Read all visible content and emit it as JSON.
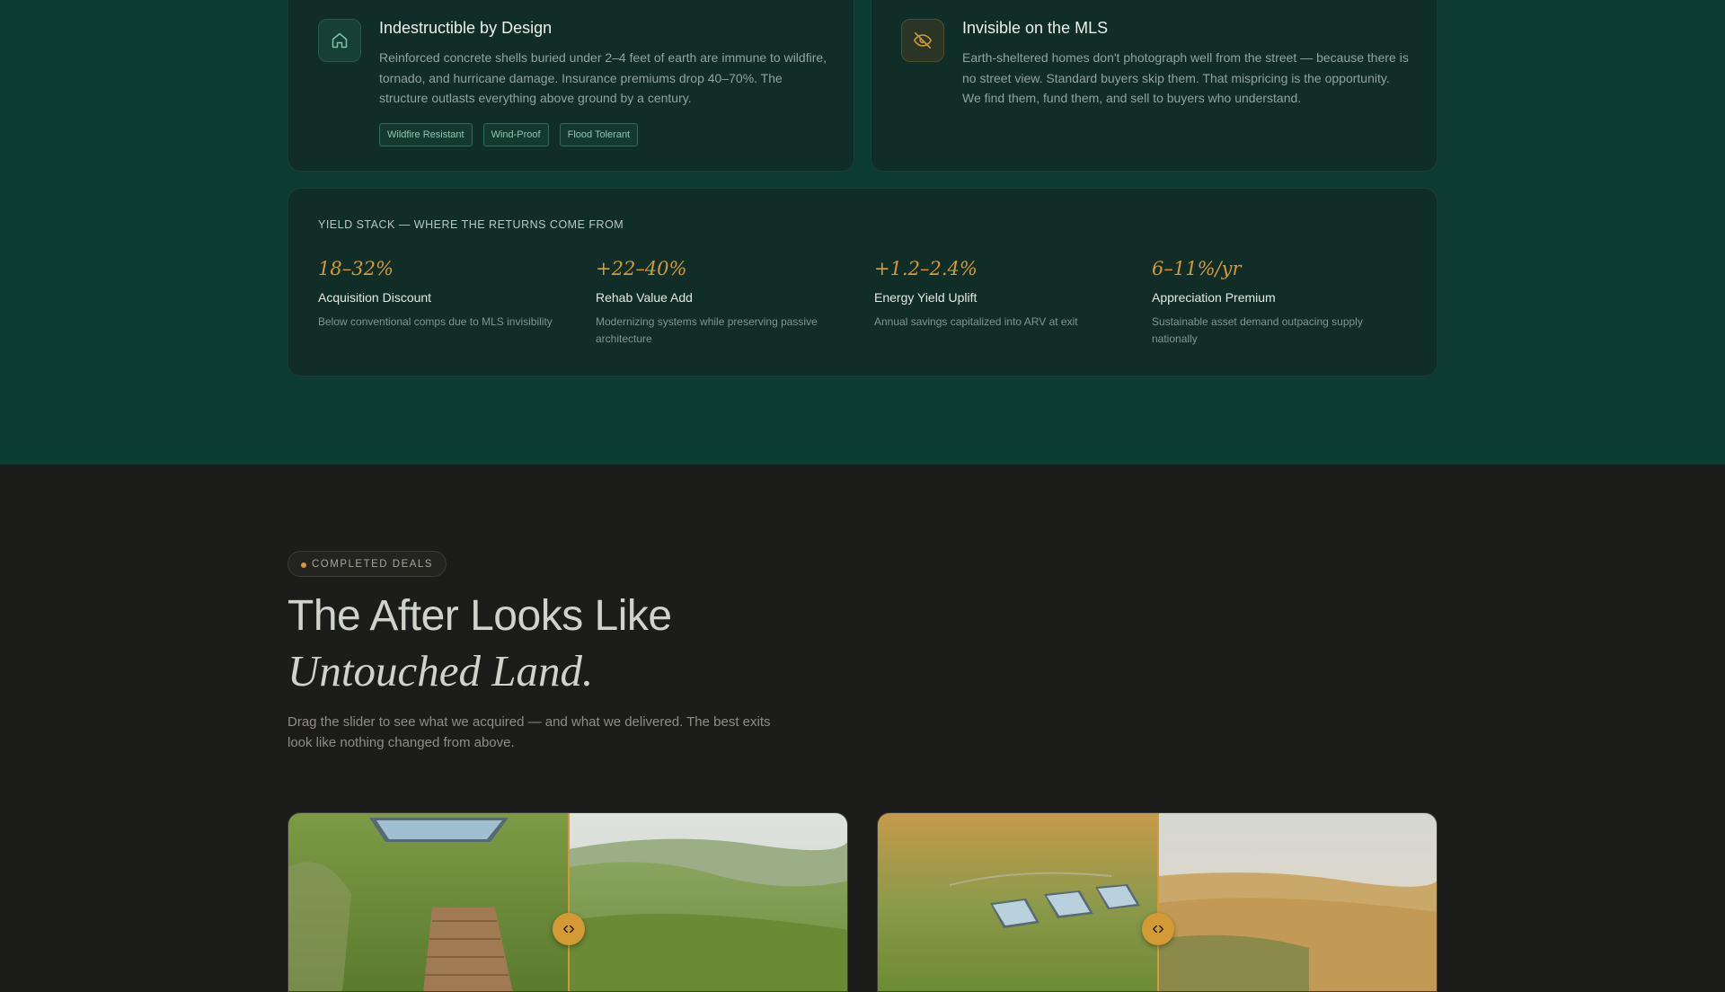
{
  "features": {
    "card1": {
      "title": "Indestructible by Design",
      "description": "Reinforced concrete shells buried under 2–4 feet of earth are immune to wildfire, tornado, and hurricane damage. Insurance premiums drop 40–70%. The structure outlasts everything above ground by a century.",
      "icon": "home-icon",
      "tags": [
        "Wildfire Resistant",
        "Wind-Proof",
        "Flood Tolerant"
      ]
    },
    "card2": {
      "title": "Invisible on the MLS",
      "description": "Earth-sheltered homes don't photograph well from the street — because there is no street view. Standard buyers skip them. That mispricing is the opportunity. We find them, fund them, and sell to buyers who understand.",
      "icon": "eye-off-icon"
    }
  },
  "yield_stack": {
    "heading": "YIELD STACK — WHERE THE RETURNS COME FROM",
    "items": [
      {
        "value": "18–32%",
        "label": "Acquisition Discount",
        "sub": "Below conventional comps due to MLS invisibility"
      },
      {
        "value": "+22–40%",
        "label": "Rehab Value Add",
        "sub": "Modernizing systems while preserving passive architecture"
      },
      {
        "value": "+1.2–2.4%",
        "label": "Energy Yield Uplift",
        "sub": "Annual savings capitalized into ARV at exit"
      },
      {
        "value": "6–11%/yr",
        "label": "Appreciation Premium",
        "sub": "Sustainable asset demand outpacing supply nationally"
      }
    ]
  },
  "deals": {
    "badge": "COMPLETED DEALS",
    "headline": "The After Looks Like",
    "headline_italic": "Untouched Land.",
    "lede": "Drag the slider to see what we acquired — and what we delivered. The best exits look like nothing changed from above.",
    "slider_icon": "drag-arrows-icon"
  },
  "colors": {
    "green_bg": "#0c3c31",
    "dark_bg": "#1c1c1a",
    "accent": "#d49a34"
  }
}
